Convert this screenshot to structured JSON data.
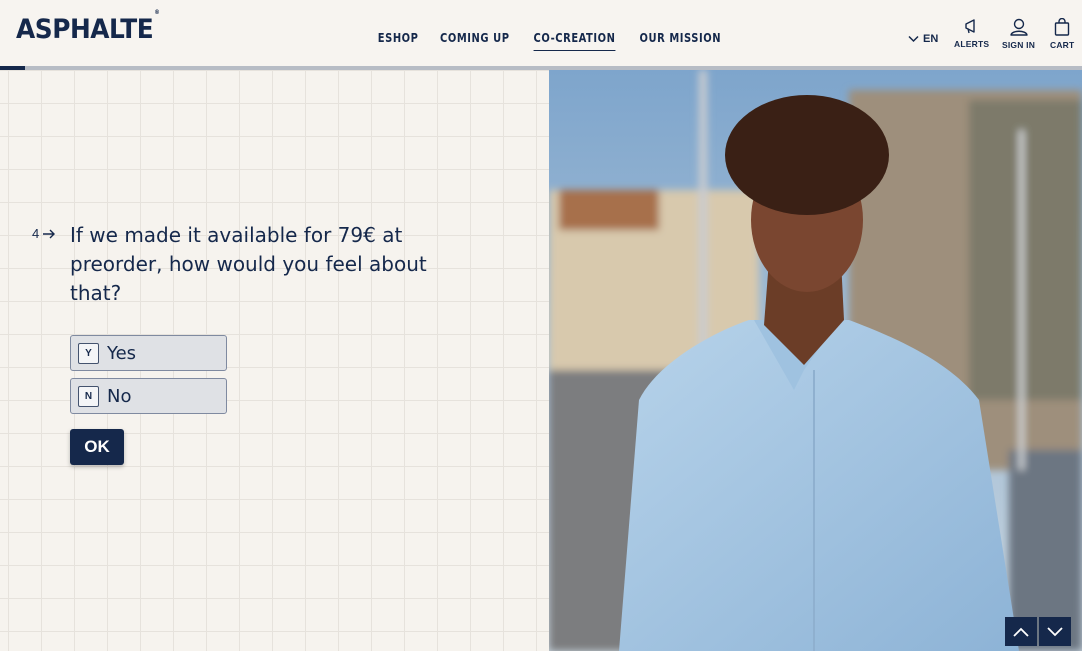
{
  "brand": {
    "name": "ASPHALTE",
    "mark": "®"
  },
  "nav": {
    "items": [
      {
        "label": "ESHOP",
        "active": false
      },
      {
        "label": "COMING UP",
        "active": false
      },
      {
        "label": "CO-CREATION",
        "active": true
      },
      {
        "label": "OUR MISSION",
        "active": false
      }
    ]
  },
  "header": {
    "language": "EN",
    "alerts_label": "ALERTS",
    "signin_label": "SIGN IN",
    "cart_label": "CART"
  },
  "survey": {
    "progress": 0.023,
    "question_number": "4",
    "question": "If we made it available for 79€ at preorder, how would you feel about that?",
    "choices": [
      {
        "key": "Y",
        "label": "Yes"
      },
      {
        "key": "N",
        "label": "No"
      }
    ],
    "submit_label": "OK"
  },
  "colors": {
    "navy": "#15284b",
    "background": "#f6f3ee",
    "choice_bg": "#dfe1e5"
  },
  "icons": [
    "chevron-down-icon",
    "megaphone-icon",
    "user-icon",
    "bag-icon",
    "arrow-right-icon",
    "chevron-up-icon"
  ]
}
